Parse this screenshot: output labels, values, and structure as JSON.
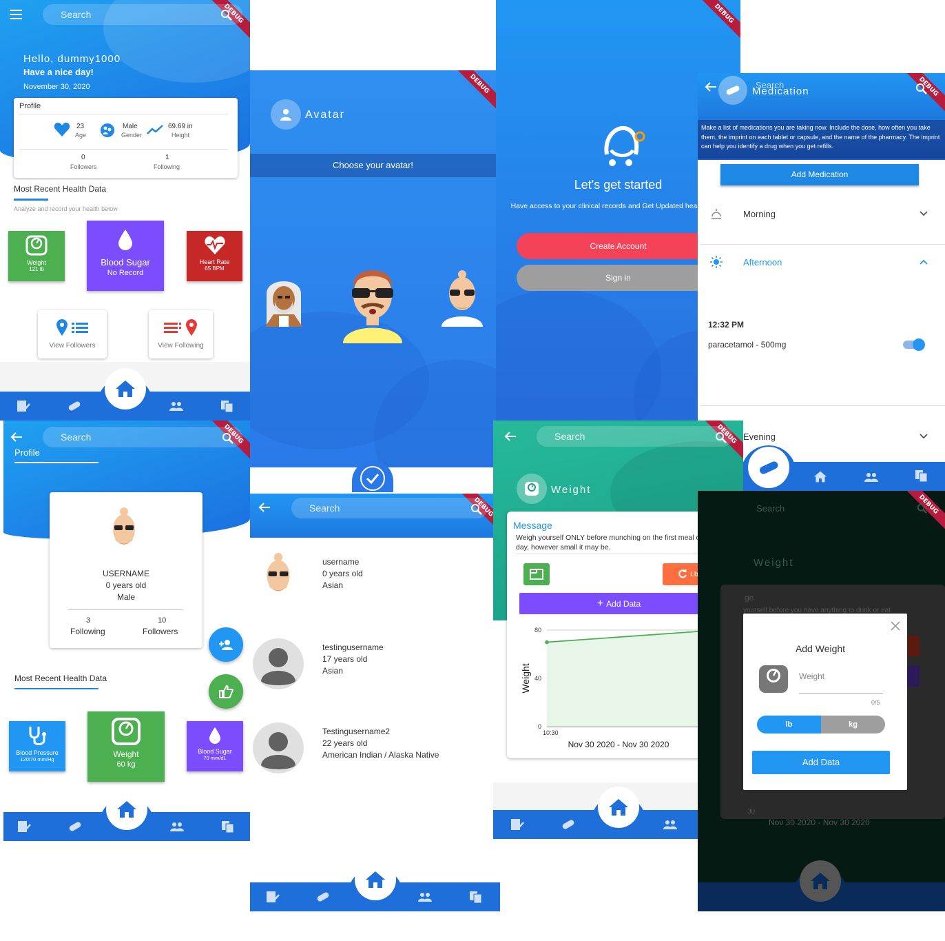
{
  "common": {
    "debug_label": "DEBUG",
    "search_placeholder": "Search"
  },
  "home": {
    "greeting": "Hello, dummy1000",
    "subgreeting": "Have a nice day!",
    "date": "November 30, 2020",
    "profile_title": "Profile",
    "age_value": "23",
    "age_label": "Age",
    "gender_value": "Male",
    "gender_label": "Gender",
    "height_value": "69.69 in",
    "height_label": "Height",
    "followers_value": "0",
    "followers_label": "Followers",
    "following_value": "1",
    "following_label": "Following",
    "section_title": "Most Recent Health Data",
    "section_hint": "Analyze and record your health below",
    "weight_title": "Weight",
    "weight_value": "121 lb",
    "sugar_title": "Blood Sugar",
    "sugar_value": "No Record",
    "heart_title": "Heart Rate",
    "heart_value": "65 BPM",
    "view_followers": "View Followers",
    "view_following": "View Following"
  },
  "avatar": {
    "title": "Avatar",
    "choose": "Choose your avatar!"
  },
  "start": {
    "title": "Let's get started",
    "desc": "Have access to your clinical records and Get Updated health status",
    "create": "Create Account",
    "signin": "Sign in"
  },
  "medication": {
    "search": "Search",
    "title": "Medication",
    "info": "Make a list of medications you are taking now. Include the dose, how often you take them, the imprint on each tablet or capsule, and the name of the pharmacy. The imprint can help you identify a drug when you get refills.",
    "add": "Add Medication",
    "morning": "Morning",
    "afternoon": "Afternoon",
    "time": "12:32 PM",
    "med": "paracetamol - 500mg",
    "evening": "Evening",
    "colors": {
      "primary": "#1e6fd9",
      "accent": "#2196f3"
    }
  },
  "profile": {
    "tab": "Profile",
    "username": "USERNAME",
    "age": "0 years old",
    "gender": "Male",
    "following_value": "3",
    "following_label": "Following",
    "followers_value": "10",
    "followers_label": "Followers",
    "section_title": "Most Recent Health Data",
    "bp_title": "Blood Pressure",
    "bp_value": "120/70 mm/Hg",
    "weight_title": "Weight",
    "weight_value": "60 kg",
    "sugar_title": "Blood Sugar",
    "sugar_value": "70 mm/dL"
  },
  "users": [
    {
      "name": "username",
      "age": "0 years old",
      "ethnicity": "Asian"
    },
    {
      "name": "testingusername",
      "age": "17 years old",
      "ethnicity": "Asian"
    },
    {
      "name": "Testingusername2",
      "age": "22 years old",
      "ethnicity": "American Indian / Alaska Native"
    }
  ],
  "weight": {
    "title": "Weight",
    "message_title": "Message",
    "message": "Weigh yourself ONLY before munching on the first meal of the day, however small it may be.",
    "unit_btn": "Lb",
    "add_data": "Add Data",
    "ylabel": "Weight",
    "date_range": "Nov 30 2020 - Nov 30 2020",
    "colors": {
      "green": "#4caf50",
      "purple": "#7c4dff",
      "orange": "#ff6e40"
    }
  },
  "chart_data": {
    "type": "line",
    "ylabel": "Weight",
    "xlabel": "Nov 30 2020 - Nov 30 2020",
    "x": [
      "10:30",
      "10:30"
    ],
    "series": [
      {
        "values": [
          70,
          80
        ]
      }
    ],
    "ylim": [
      0,
      80
    ],
    "yticks": [
      "0",
      "40",
      "80"
    ],
    "xtick_label": "10:30"
  },
  "dialog": {
    "bg_search": "Search",
    "bg_title": "Weight",
    "bg_msg": "ge",
    "bg_msg2": "yourself before you have anything to drink or eat",
    "bg_date": "Nov 30 2020 - Nov 30 2020",
    "bg_tick": "30",
    "title": "Add Weight",
    "field_label": "Weight",
    "counter": "0/5",
    "lb": "lb",
    "kg": "kg",
    "add": "Add Data"
  }
}
